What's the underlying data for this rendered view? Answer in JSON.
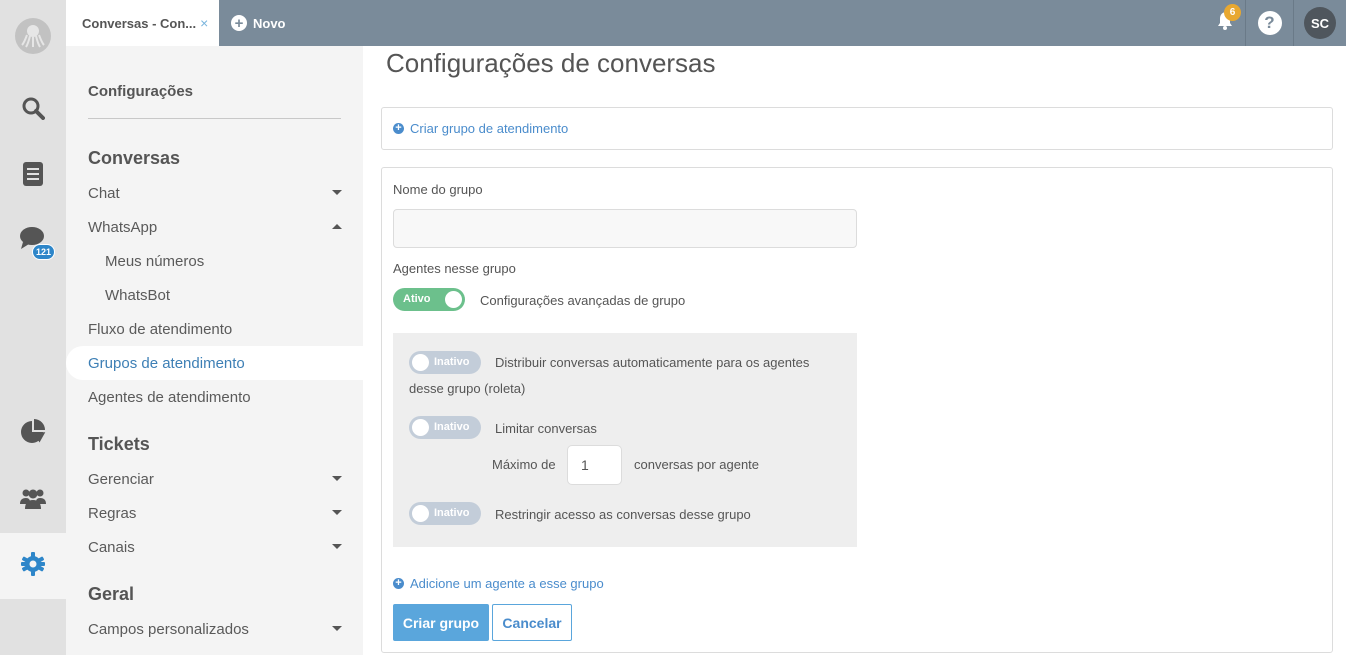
{
  "app": {
    "tabs": [
      {
        "label": "Conversas - Con...",
        "active": true,
        "close_icon": "×"
      }
    ],
    "new_tab_label": "Novo",
    "notifications_count": "6",
    "help_icon": "?",
    "user_initials": "SC"
  },
  "rail": {
    "items": [
      {
        "name": "search",
        "icon": "search-icon"
      },
      {
        "name": "tickets",
        "icon": "document-icon"
      },
      {
        "name": "conversations",
        "icon": "chat-bubble-icon",
        "badge": "121"
      },
      {
        "name": "reports",
        "icon": "pie-chart-icon"
      },
      {
        "name": "contacts",
        "icon": "users-icon"
      },
      {
        "name": "settings",
        "icon": "gear-icon",
        "active": true
      }
    ]
  },
  "sidenav": {
    "title": "Configurações",
    "groups": [
      {
        "label": "Conversas",
        "items": [
          {
            "label": "Chat",
            "caret": "down"
          },
          {
            "label": "WhatsApp",
            "caret": "up"
          },
          {
            "label": "Meus números",
            "sub": true
          },
          {
            "label": "WhatsBot",
            "sub": true
          },
          {
            "label": "Fluxo de atendimento"
          },
          {
            "label": "Grupos de atendimento",
            "active": true
          },
          {
            "label": "Agentes de atendimento"
          }
        ]
      },
      {
        "label": "Tickets",
        "items": [
          {
            "label": "Gerenciar",
            "caret": "down"
          },
          {
            "label": "Regras",
            "caret": "down"
          },
          {
            "label": "Canais",
            "caret": "down"
          }
        ]
      },
      {
        "label": "Geral",
        "items": [
          {
            "label": "Campos personalizados",
            "caret": "down"
          }
        ]
      }
    ]
  },
  "main": {
    "title": "Configurações de conversas",
    "create_group_link": "Criar grupo de atendimento",
    "form": {
      "group_name_label": "Nome do grupo",
      "group_name_value": "",
      "agents_label": "Agentes nesse grupo",
      "advanced_toggle": {
        "state_label": "Ativo",
        "on": true,
        "label": "Configurações avançadas de grupo"
      },
      "options": [
        {
          "state_label": "Inativo",
          "on": false,
          "label": "Distribuir conversas automaticamente para os agentes desse grupo (roleta)"
        },
        {
          "state_label": "Inativo",
          "on": false,
          "label": "Limitar conversas"
        },
        {
          "state_label": "Inativo",
          "on": false,
          "label": "Restringir acesso as conversas desse grupo"
        }
      ],
      "max_prefix": "Máximo de",
      "max_value": "1",
      "max_suffix": "conversas por agente",
      "add_agent_link": "Adicione um agente a esse grupo",
      "submit_label": "Criar grupo",
      "cancel_label": "Cancelar"
    }
  },
  "colors": {
    "topbar": "#7a8b9a",
    "accent_blue": "#4a8ccc",
    "primary_button": "#5aa6dc",
    "toggle_on": "#6cc08c",
    "toggle_off": "#c3cdd9",
    "notification_badge": "#e8a830"
  }
}
